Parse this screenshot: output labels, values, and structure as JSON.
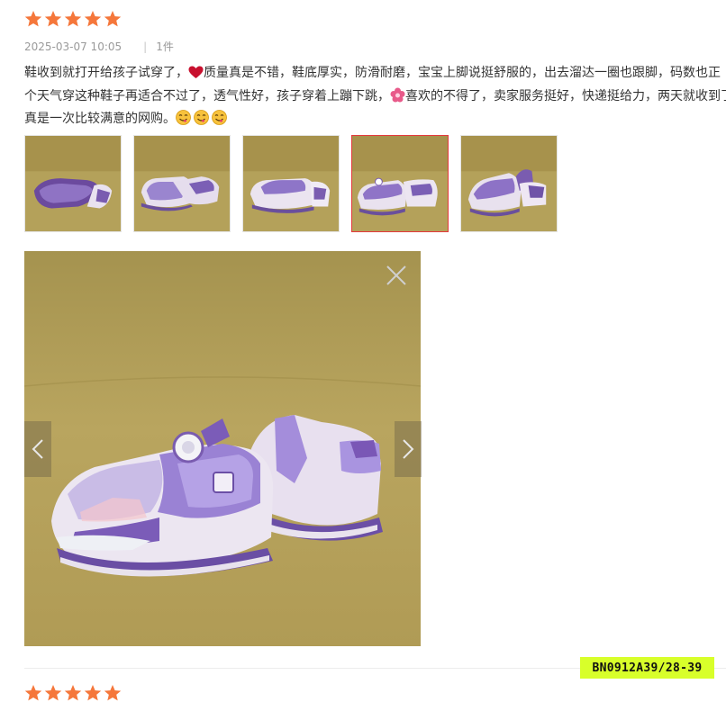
{
  "review": {
    "rating": 5,
    "date": "2025-03-07 10:05",
    "quantity": "1件",
    "text_lines": [
      [
        "鞋收到就打开给孩子试穿了，",
        "heart",
        "质量真是不错，鞋底厚实，防滑耐磨，宝宝上脚说挺舒服的，出去溜达一圈也跟脚，码数也正"
      ],
      [
        "个天气穿这种鞋子再适合不过了，透气性好，孩子穿着上蹦下跳，",
        "flower",
        "喜欢的不得了，卖家服务挺好，快递挺给力，两天就收到了"
      ],
      [
        "真是一次比较满意的网购。",
        "yum",
        "",
        "yum",
        "",
        "yum",
        ""
      ]
    ],
    "thumbnails_count": 5,
    "active_thumbnail": 4
  },
  "sku_label": "BN0912A39/28-39",
  "icons": {
    "star": "star-icon",
    "close": "close-icon",
    "prev": "chevron-left-icon",
    "next": "chevron-right-icon"
  },
  "colors": {
    "star": "#f5773b",
    "accent": "#e4393c",
    "sku_bg": "#d8ff2a"
  }
}
